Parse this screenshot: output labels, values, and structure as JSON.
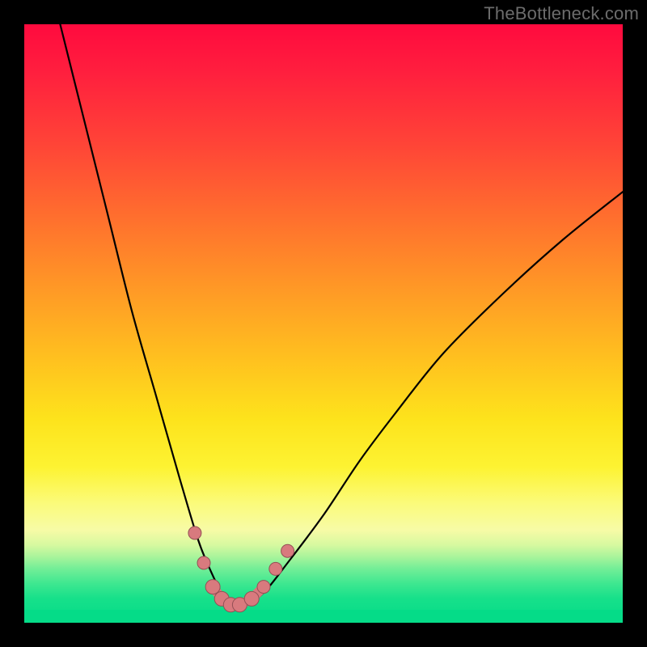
{
  "watermark": "TheBottleneck.com",
  "chart_data": {
    "type": "line",
    "title": "",
    "xlabel": "",
    "ylabel": "",
    "xlim": [
      0,
      100
    ],
    "ylim": [
      0,
      100
    ],
    "grid": false,
    "series": [
      {
        "name": "bottleneck-curve",
        "x": [
          6,
          10,
          14,
          18,
          22,
          26,
          29,
          31,
          33,
          35,
          37,
          40,
          44,
          50,
          56,
          62,
          70,
          80,
          90,
          100
        ],
        "y": [
          100,
          84,
          68,
          52,
          38,
          24,
          14,
          9,
          5,
          3,
          3,
          5,
          10,
          18,
          27,
          35,
          45,
          55,
          64,
          72
        ]
      }
    ],
    "markers": {
      "name": "highlighted-points",
      "color": "#d87a7e",
      "x": [
        28.5,
        30.0,
        31.5,
        33.0,
        34.5,
        36.0,
        38.0,
        40.0,
        42.0,
        44.0
      ],
      "y": [
        15,
        10,
        6,
        4,
        3,
        3,
        4,
        6,
        9,
        12
      ]
    },
    "colors": {
      "background_top": "#ff0a3e",
      "background_bottom": "#05dc88",
      "curve": "#000000",
      "markers": "#d87a7e"
    }
  }
}
